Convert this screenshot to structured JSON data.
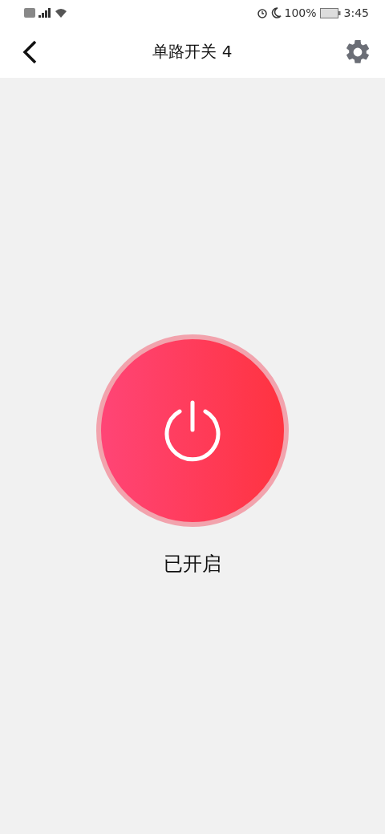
{
  "status_bar": {
    "battery": "100%",
    "time": "3:45"
  },
  "header": {
    "title": "单路开关 4"
  },
  "power": {
    "on": true,
    "label": "已开启"
  }
}
